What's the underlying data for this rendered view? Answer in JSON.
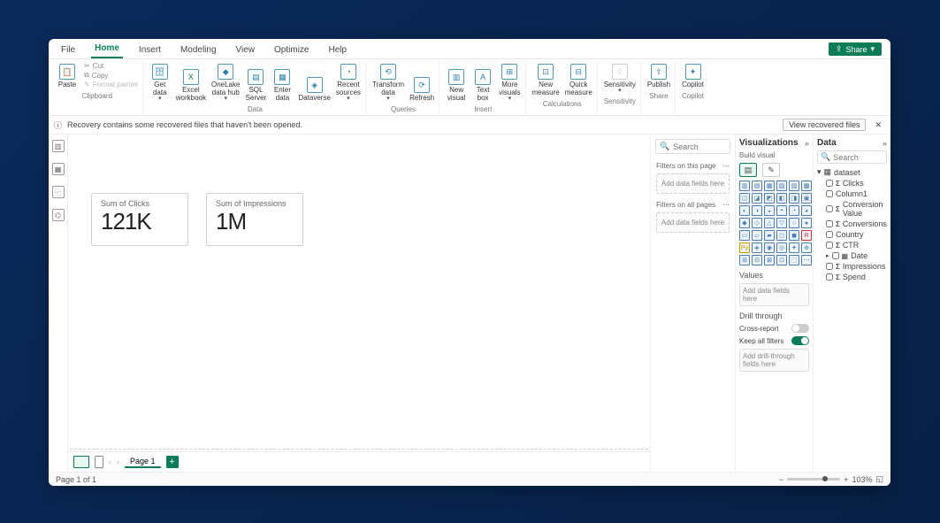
{
  "tabs": {
    "file": "File",
    "home": "Home",
    "insert": "Insert",
    "modeling": "Modeling",
    "view": "View",
    "optimize": "Optimize",
    "help": "Help"
  },
  "share_label": "Share",
  "ribbon": {
    "clipboard": {
      "paste": "Paste",
      "cut": "Cut",
      "copy": "Copy",
      "format": "Format painter",
      "group": "Clipboard"
    },
    "data": {
      "get": "Get\ndata",
      "excel": "Excel\nworkbook",
      "onelake": "OneLake\ndata hub",
      "sql": "SQL\nServer",
      "enter": "Enter\ndata",
      "dataverse": "Dataverse",
      "recent": "Recent\nsources",
      "group": "Data"
    },
    "queries": {
      "transform": "Transform\ndata",
      "refresh": "Refresh",
      "group": "Queries"
    },
    "insert": {
      "newvisual": "New\nvisual",
      "textbox": "Text\nbox",
      "morevisuals": "More\nvisuals",
      "group": "Insert"
    },
    "calc": {
      "newmeasure": "New\nmeasure",
      "quickmeasure": "Quick\nmeasure",
      "group": "Calculations"
    },
    "sens": {
      "sensitivity": "Sensitivity",
      "group": "Sensitivity"
    },
    "share": {
      "publish": "Publish",
      "group": "Share"
    },
    "copilot": {
      "copilot": "Copilot",
      "group": "Copilot"
    }
  },
  "msgbar": {
    "text": "Recovery contains some recovered files that haven't been opened.",
    "button": "View recovered files"
  },
  "filters": {
    "search_placeholder": "Search",
    "this_page": "Filters on this page",
    "all_pages": "Filters on all pages",
    "placeholder": "Add data fields here"
  },
  "viz": {
    "title": "Visualizations",
    "build": "Build visual",
    "values": "Values",
    "values_ph": "Add data fields here",
    "drill": "Drill through",
    "cross": "Cross-report",
    "keep": "Keep all filters",
    "drill_ph": "Add drill-through fields here"
  },
  "data": {
    "title": "Data",
    "search_placeholder": "Search",
    "dataset": "dataset",
    "fields": [
      {
        "name": "Clicks",
        "agg": true
      },
      {
        "name": "Column1",
        "agg": false
      },
      {
        "name": "Conversion Value",
        "agg": true
      },
      {
        "name": "Conversions",
        "agg": true
      },
      {
        "name": "Country",
        "agg": false
      },
      {
        "name": "CTR",
        "agg": true
      },
      {
        "name": "Date",
        "agg": false,
        "hier": true
      },
      {
        "name": "Impressions",
        "agg": true
      },
      {
        "name": "Spend",
        "agg": true
      }
    ]
  },
  "canvas": {
    "cards": [
      {
        "title": "Sum of Clicks",
        "value": "121K"
      },
      {
        "title": "Sum of Impressions",
        "value": "1M"
      }
    ]
  },
  "pages": {
    "current": "Page 1"
  },
  "status": {
    "page": "Page 1 of 1",
    "zoom": "103%"
  }
}
